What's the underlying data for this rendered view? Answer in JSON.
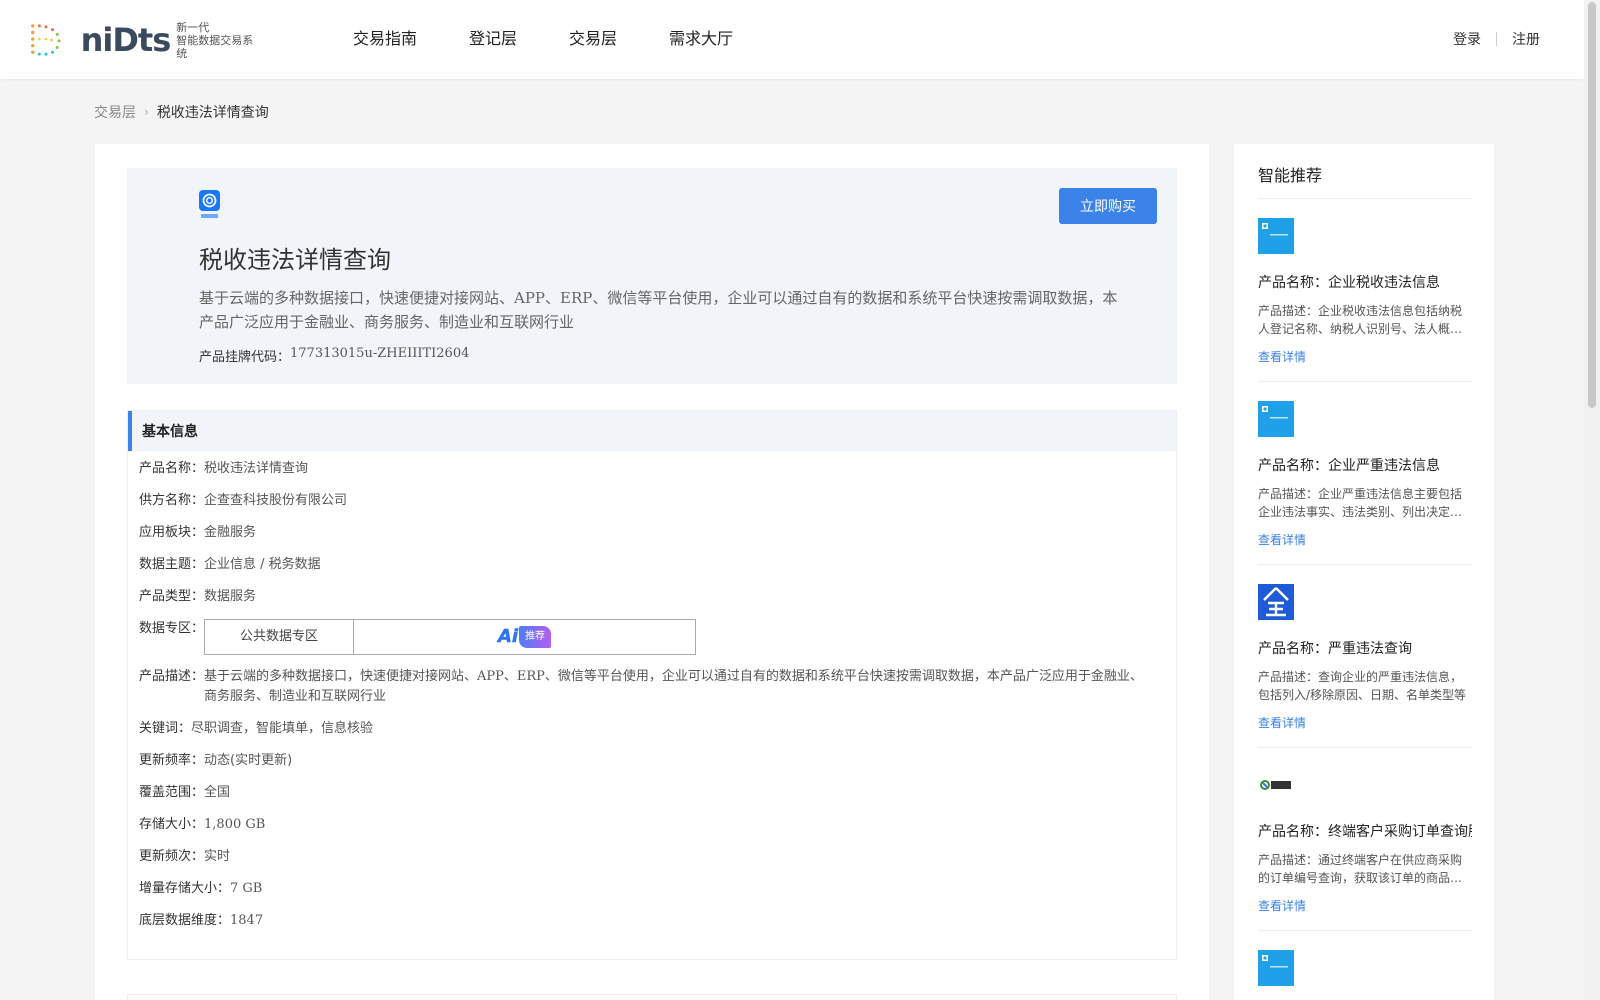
{
  "header": {
    "logo_word": "niDts",
    "logo_sub1": "新一代",
    "logo_sub2": "智能数据交易系统",
    "nav": [
      "交易指南",
      "登记层",
      "交易层",
      "需求大厅"
    ],
    "login": "登录",
    "register": "注册"
  },
  "breadcrumb": {
    "parent": "交易层",
    "arrow": ">",
    "current": "税收违法详情查询"
  },
  "hero": {
    "title": "税收违法详情查询",
    "desc": "基于云端的多种数据接口，快速便捷对接网站、APP、ERP、微信等平台使用，企业可以通过自有的数据和系统平台快速按需调取数据，本产品广泛应用于金融业、商务服务、制造业和互联网行业",
    "code_label": "产品挂牌代码：",
    "code_value": "177313015u-ZHEIIITI2604",
    "buy_label": "立即购买"
  },
  "basic": {
    "title": "基本信息",
    "product_name_label": "产品名称：",
    "product_name": "税收违法详情查询",
    "supplier_label": "供方名称：",
    "supplier": "企查查科技股份有限公司",
    "sector_label": "应用板块：",
    "sector": "金融服务",
    "topic_label": "数据主题：",
    "topic": "企业信息 / 税务数据",
    "type_label": "产品类型：",
    "type": "数据服务",
    "zone_label": "数据专区：",
    "zone": "公共数据专区",
    "ai_letters": "Ai",
    "ai_tag": "推荐",
    "desc_label": "产品描述：",
    "desc": "基于云端的多种数据接口，快速便捷对接网站、APP、ERP、微信等平台使用，企业可以通过自有的数据和系统平台快速按需调取数据，本产品广泛应用于金融业、商务服务、制造业和互联网行业",
    "keywords_label": "关键词：",
    "keywords": "尽职调查，智能填单，信息核验",
    "freq_label": "更新频率：",
    "freq": "动态(实时更新)",
    "coverage_label": "覆盖范围：",
    "coverage": "全国",
    "storage_label": "存储大小：",
    "storage": "1,800 GB",
    "update_times_label": "更新频次：",
    "update_times": "实时",
    "inc_label": "增量存储大小：",
    "inc": "7 GB",
    "dim_label": "底层数据维度：",
    "dim": "1847"
  },
  "sidebar": {
    "title": "智能推荐",
    "link_label": "查看详情",
    "items": [
      {
        "name": "产品名称：企业税收违法信息",
        "desc": "产品描述：企业税收违法信息包括纳税人登记名称、纳税人识别号、法人概况等"
      },
      {
        "name": "产品名称：企业严重违法信息",
        "desc": "产品描述：企业严重违法信息主要包括企业违法事实、违法类别、列出决定机关等"
      },
      {
        "name": "产品名称：严重违法查询",
        "desc": "产品描述：查询企业的严重违法信息，包括列入/移除原因、日期、名单类型等"
      },
      {
        "name": "产品名称：终端客户采购订单查询服务",
        "desc": "产品描述：通过终端客户在供应商采购的订单编号查询，获取该订单的商品信息"
      }
    ]
  }
}
